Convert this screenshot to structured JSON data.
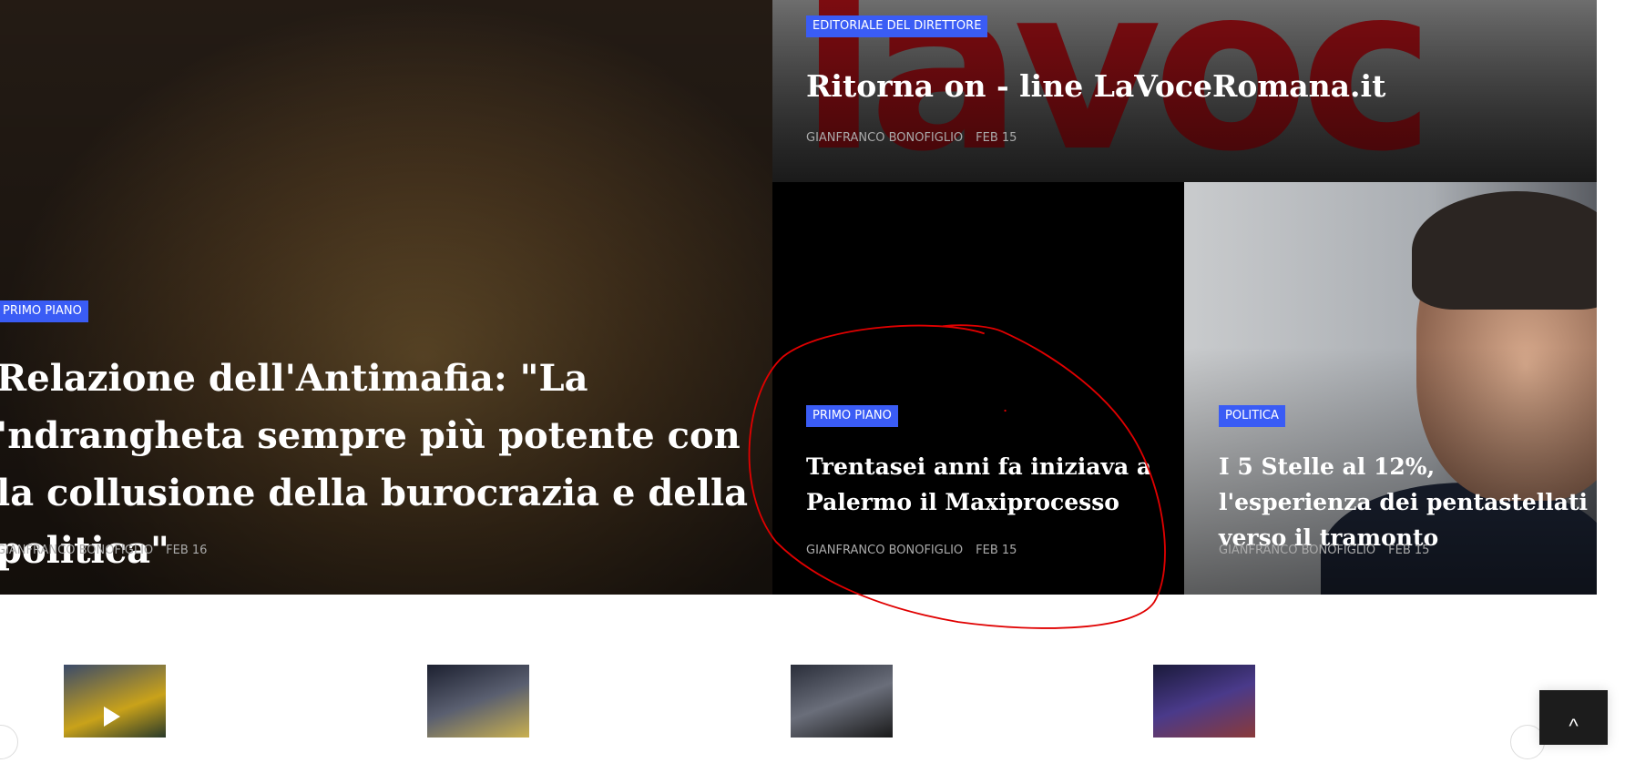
{
  "featured": {
    "category": "Primo Piano",
    "title": "Relazione dell'Antimafia: \"La 'ndrangheta sempre più potente con la collusione della burocrazia e della politica\"",
    "author": "Gianfranco Bonofiglio",
    "date": "Feb 16"
  },
  "top_right": {
    "category": "Editoriale del direttore",
    "title": "Ritorna on - line LaVoceRomana.it",
    "author": "Gianfranco Bonofiglio",
    "date": "Feb 15",
    "logo_text": "lavoce"
  },
  "middle": {
    "category": "Primo Piano",
    "title": "Trentasei anni fa iniziava a Palermo il Maxiprocesso",
    "author": "Gianfranco Bonofiglio",
    "date": "Feb 15"
  },
  "right": {
    "category": "Politica",
    "title": "I 5 Stelle al 12%, l'esperienza dei pentastellati verso il tramonto",
    "author": "Gianfranco Bonofiglio",
    "date": "Feb 15"
  },
  "back_to_top": {
    "icon": "chevron-up-icon",
    "glyph": "^"
  },
  "colors": {
    "badge": "#3a5cf5",
    "annotation": "#e00000"
  }
}
